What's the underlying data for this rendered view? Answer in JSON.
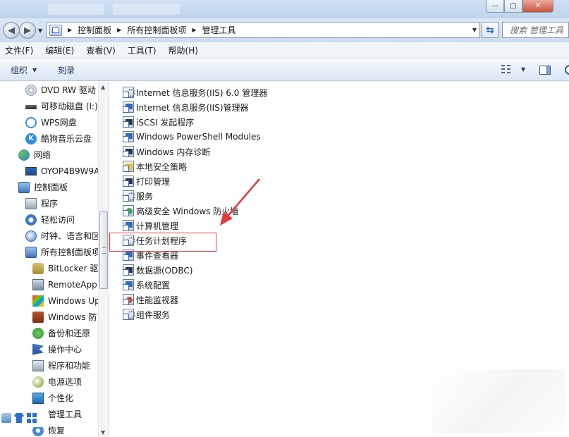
{
  "window": {
    "controls": {
      "minimize": "—",
      "maximize": "□",
      "close": "✕"
    }
  },
  "address": {
    "breadcrumbs": [
      "控制面板",
      "所有控制面板项",
      "管理工具"
    ],
    "search_placeholder": "搜索 管理工具"
  },
  "menu": [
    "文件(F)",
    "编辑(E)",
    "查看(V)",
    "工具(T)",
    "帮助(H)"
  ],
  "commands": {
    "organize": "组织",
    "burn": "刻录"
  },
  "nav": [
    {
      "label": "DVD RW 驱动",
      "icon": "dvd-drive-icon"
    },
    {
      "label": "可移动磁盘 (I:)",
      "icon": "removable-disk-icon"
    },
    {
      "label": "WPS网盘",
      "icon": "wps-cloud-icon"
    },
    {
      "label": "酷狗音乐云盘",
      "icon": "kugou-cloud-icon"
    },
    {
      "label": "网络",
      "icon": "network-icon"
    },
    {
      "label": "OYOP4B9W9A",
      "icon": "computer-icon"
    },
    {
      "label": "控制面板",
      "icon": "control-panel-icon"
    },
    {
      "label": "程序",
      "icon": "programs-icon"
    },
    {
      "label": "轻松访问",
      "icon": "ease-of-access-icon"
    },
    {
      "label": "时钟、语言和区",
      "icon": "clock-language-icon"
    },
    {
      "label": "所有控制面板项",
      "icon": "all-control-panel-icon"
    },
    {
      "label": "BitLocker 驱",
      "icon": "bitlocker-icon"
    },
    {
      "label": "RemoteApp",
      "icon": "remoteapp-icon"
    },
    {
      "label": "Windows Up",
      "icon": "windows-update-icon"
    },
    {
      "label": "Windows 防",
      "icon": "firewall-icon"
    },
    {
      "label": "备份和还原",
      "icon": "backup-icon"
    },
    {
      "label": "操作中心",
      "icon": "action-center-icon"
    },
    {
      "label": "程序和功能",
      "icon": "programs-features-icon"
    },
    {
      "label": "电源选项",
      "icon": "power-icon"
    },
    {
      "label": "个性化",
      "icon": "personalization-icon"
    },
    {
      "label": "管理工具",
      "icon": "admin-tools-icon"
    },
    {
      "label": "恢复",
      "icon": "recovery-icon"
    }
  ],
  "files": [
    {
      "label": "Internet 信息服务(IIS) 6.0 管理器",
      "icon": "iis6-manager-icon"
    },
    {
      "label": "Internet 信息服务(IIS)管理器",
      "icon": "iis-manager-icon"
    },
    {
      "label": "iSCSI 发起程序",
      "icon": "iscsi-icon"
    },
    {
      "label": "Windows PowerShell Modules",
      "icon": "powershell-icon"
    },
    {
      "label": "Windows 内存诊断",
      "icon": "memory-diagnostic-icon"
    },
    {
      "label": "本地安全策略",
      "icon": "local-security-policy-icon"
    },
    {
      "label": "打印管理",
      "icon": "print-management-icon"
    },
    {
      "label": "服务",
      "icon": "services-icon"
    },
    {
      "label": "高级安全 Windows 防火墙",
      "icon": "advanced-firewall-icon"
    },
    {
      "label": "计算机管理",
      "icon": "computer-management-icon"
    },
    {
      "label": "任务计划程序",
      "icon": "task-scheduler-icon"
    },
    {
      "label": "事件查看器",
      "icon": "event-viewer-icon"
    },
    {
      "label": "数据源(ODBC)",
      "icon": "odbc-icon"
    },
    {
      "label": "系统配置",
      "icon": "system-config-icon"
    },
    {
      "label": "性能监视器",
      "icon": "performance-monitor-icon"
    },
    {
      "label": "组件服务",
      "icon": "component-services-icon"
    }
  ],
  "annotation": {
    "highlight_color": "#e33b3b"
  }
}
